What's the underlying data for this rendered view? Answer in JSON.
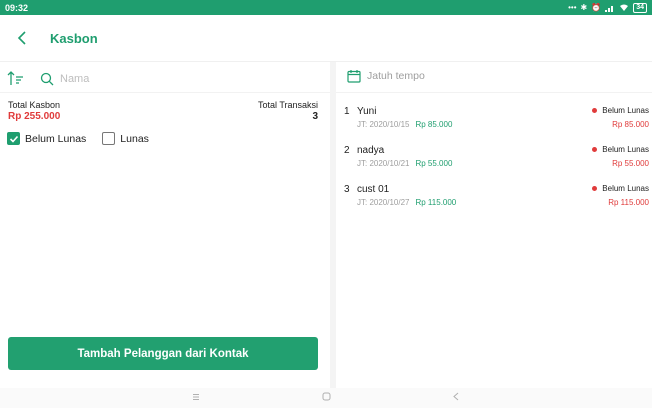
{
  "status_bar": {
    "time": "09:32",
    "icons": [
      "dots-icon",
      "bluetooth-icon",
      "alarm-icon",
      "signal-icon",
      "wifi-icon"
    ],
    "battery": "34"
  },
  "header": {
    "title": "Kasbon"
  },
  "search": {
    "placeholder": "Nama"
  },
  "date_filter": {
    "label": "Jatuh tempo"
  },
  "summary": {
    "total_label": "Total Kasbon",
    "total_value": "Rp 255.000",
    "count_label": "Total Transaksi",
    "count_value": "3"
  },
  "filters": [
    {
      "label": "Belum Lunas",
      "checked": true
    },
    {
      "label": "Lunas",
      "checked": false
    }
  ],
  "add_button": {
    "label": "Tambah Pelanggan dari Kontak"
  },
  "list": [
    {
      "index": "1",
      "name": "Yuni",
      "due": "JT: 2020/10/15",
      "amount": "Rp 85.000",
      "status": "Belum Lunas",
      "remaining": "Rp 85.000"
    },
    {
      "index": "2",
      "name": "nadya",
      "due": "JT: 2020/10/21",
      "amount": "Rp 55.000",
      "status": "Belum Lunas",
      "remaining": "Rp 55.000"
    },
    {
      "index": "3",
      "name": "cust 01",
      "due": "JT: 2020/10/27",
      "amount": "Rp 115.000",
      "status": "Belum Lunas",
      "remaining": "Rp 115.000"
    }
  ],
  "colors": {
    "accent": "#1f9e6f",
    "danger": "#e03b3b"
  }
}
